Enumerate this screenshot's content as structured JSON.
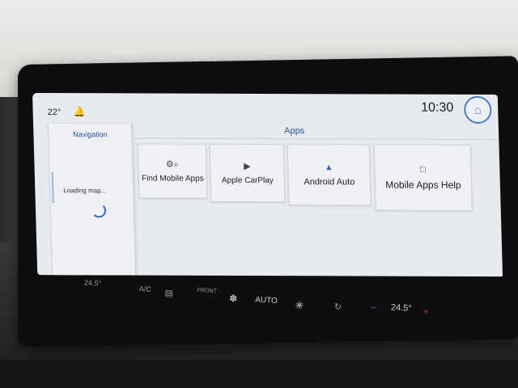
{
  "status": {
    "temperature": "22°",
    "clock": "10:30"
  },
  "navigation": {
    "title": "Navigation",
    "loading_text": "Loading map..."
  },
  "apps": {
    "title": "Apps",
    "tiles": [
      {
        "label": "Find Mobile Apps",
        "icon": "find-apps-icon"
      },
      {
        "label": "Apple CarPlay",
        "icon": "carplay-icon"
      },
      {
        "label": "Android Auto",
        "icon": "android-auto-icon"
      },
      {
        "label": "Mobile Apps Help",
        "icon": "help-icon"
      }
    ]
  },
  "climate": {
    "left_temp": "24.5°",
    "ac": "A/C",
    "front": "FRONT",
    "auto": "AUTO",
    "right_temp": "24.5°"
  },
  "colors": {
    "accent": "#4f78c6",
    "screen_bg": "#e7eaef"
  }
}
